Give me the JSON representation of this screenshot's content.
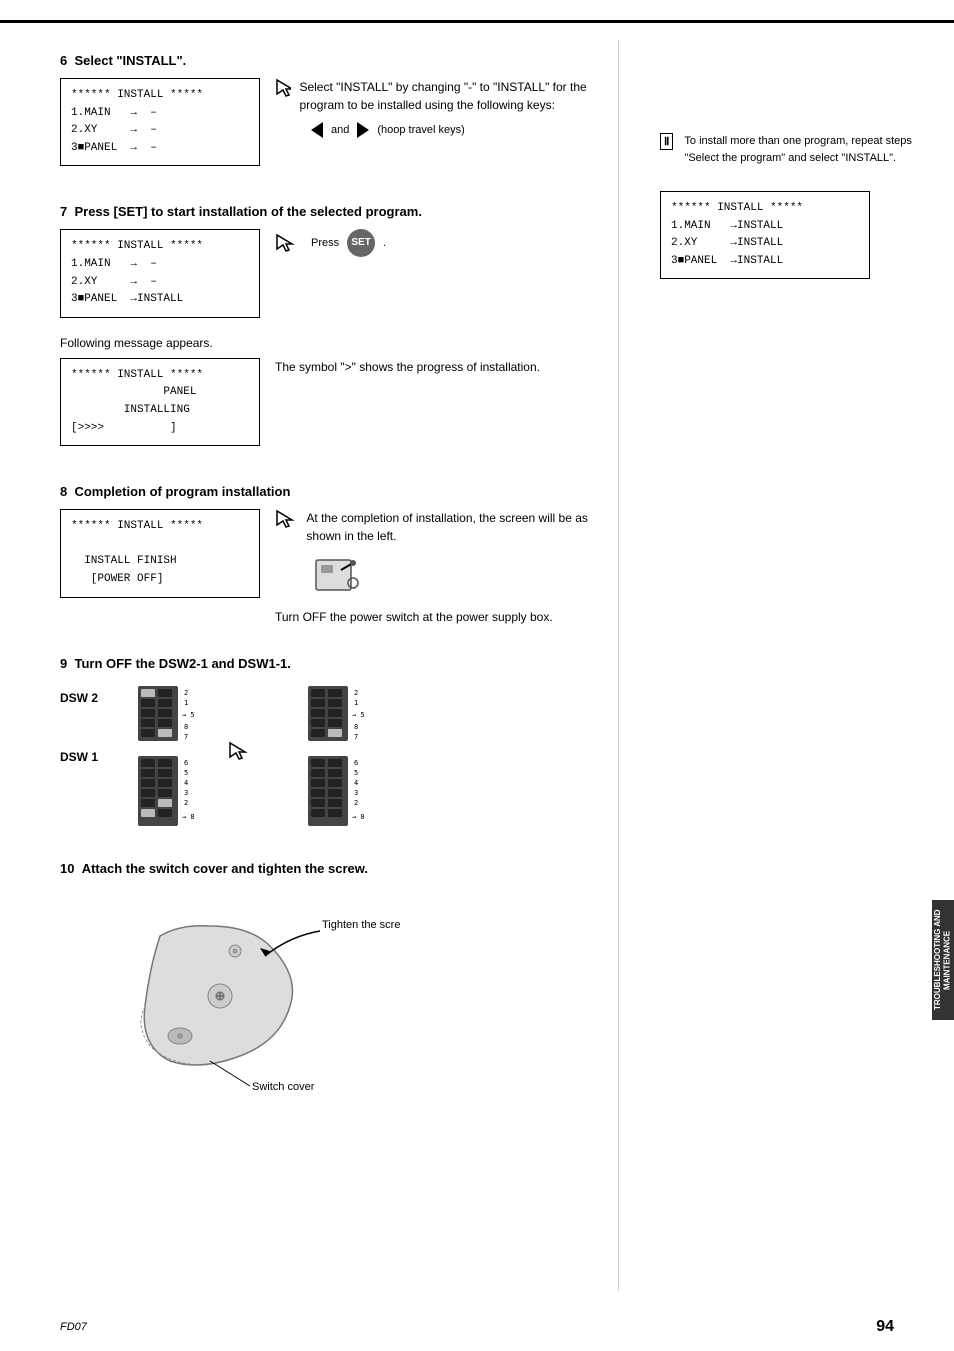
{
  "page": {
    "footer_code": "FD07",
    "footer_page": "94"
  },
  "side_tab": {
    "text": "TROUBLESHOOTING\nAND MAINTENANCE"
  },
  "sections": [
    {
      "number": "6",
      "title": "Select \"INSTALL\".",
      "lcd1": {
        "lines": [
          "****** INSTALL *****",
          "1.MAIN   →  –",
          "2.XY     →  –",
          "3■PANEL  →  –"
        ]
      },
      "desc": "Select \"INSTALL\" by changing \"-\" to \"INSTALL\" for the program to be installed using the following keys:",
      "hoop_keys_label": "(hoop travel keys)"
    },
    {
      "number": "7",
      "title": "Press [SET] to start installation of the selected program.",
      "lcd2": {
        "lines": [
          "****** INSTALL *****",
          "1.MAIN   →  –",
          "2.XY     →  –",
          "3■PANEL  →INSTALL"
        ]
      },
      "press_set_label": "Press",
      "set_button_label": "SET",
      "following_msg": "Following message appears.",
      "lcd3": {
        "lines": [
          "****** INSTALL *****",
          "              PANEL",
          "        INSTALLING",
          "[>>>            ]"
        ]
      },
      "progress_desc": "The symbol \">\" shows the progress of installation.",
      "note_label": "To install more than one program, repeat steps \"Select the program\" and select \"INSTALL\".",
      "right_lcd": {
        "lines": [
          "****** INSTALL *****",
          "1.MAIN   →INSTALL",
          "2.XY     →INSTALL",
          "3■PANEL  →INSTALL"
        ]
      }
    },
    {
      "number": "8",
      "title": "Completion of program installation",
      "lcd4": {
        "lines": [
          "****** INSTALL *****",
          "",
          "  INSTALL FINISH",
          "   [POWER OFF]"
        ]
      },
      "completion_desc": "At the completion of installation, the screen will be as shown in the left.",
      "power_desc": "Turn OFF the power switch at the power supply box."
    },
    {
      "number": "9",
      "title": "Turn OFF the DSW2-1 and DSW1-1.",
      "dsw2_label": "DSW 2",
      "dsw1_label": "DSW 1"
    },
    {
      "number": "10",
      "title": "Attach the switch cover and tighten the screw.",
      "tighten_label": "Tighten the screw.",
      "switch_cover_label": "Switch cover"
    }
  ]
}
